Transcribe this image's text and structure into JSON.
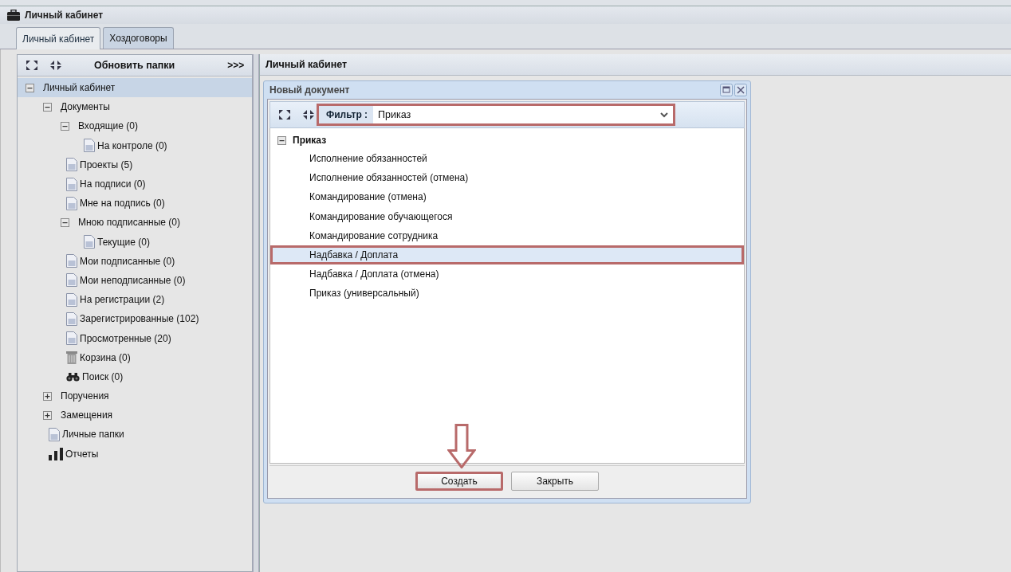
{
  "window": {
    "title": "Личный кабинет"
  },
  "tabs": [
    {
      "label": "Личный кабинет",
      "selected": true
    },
    {
      "label": "Хоздоговоры",
      "selected": false
    }
  ],
  "sidebar": {
    "toolbar": {
      "refresh": "Обновить папки",
      "more": ">>>"
    },
    "tree": [
      {
        "label": "Личный кабинет",
        "kind": "folder",
        "expanded": true,
        "selected": true,
        "children": [
          {
            "label": "Документы",
            "kind": "folder",
            "expanded": true,
            "selected": false,
            "children": [
              {
                "label": "Входящие (0)",
                "kind": "folder",
                "expanded": true,
                "selected": false,
                "children": [
                  {
                    "label": "На контроле (0)",
                    "kind": "document",
                    "selected": false
                  }
                ]
              },
              {
                "label": "Проекты (5)",
                "kind": "document",
                "selected": false
              },
              {
                "label": "На подписи (0)",
                "kind": "document",
                "selected": false
              },
              {
                "label": "Мне на подпись (0)",
                "kind": "document",
                "selected": false
              },
              {
                "label": "Мною подписанные (0)",
                "kind": "folder",
                "expanded": true,
                "selected": false,
                "children": [
                  {
                    "label": "Текущие (0)",
                    "kind": "document",
                    "selected": false
                  }
                ]
              },
              {
                "label": "Мои подписанные (0)",
                "kind": "document",
                "selected": false
              },
              {
                "label": "Мои неподписанные (0)",
                "kind": "document",
                "selected": false
              },
              {
                "label": "На регистрации (2)",
                "kind": "document",
                "selected": false
              },
              {
                "label": "Зарегистрированные (102)",
                "kind": "document",
                "selected": false
              },
              {
                "label": "Просмотренные (20)",
                "kind": "document",
                "selected": false
              },
              {
                "label": "Корзина (0)",
                "kind": "trash",
                "selected": false
              },
              {
                "label": "Поиск (0)",
                "kind": "search",
                "selected": false
              }
            ]
          },
          {
            "label": "Поручения",
            "kind": "folder",
            "expanded": false,
            "selected": false
          },
          {
            "label": "Замещения",
            "kind": "folder",
            "expanded": false,
            "selected": false
          },
          {
            "label": "Личные папки",
            "kind": "document",
            "selected": false
          },
          {
            "label": "Отчеты",
            "kind": "chart",
            "selected": false
          }
        ]
      }
    ]
  },
  "main": {
    "title": "Личный кабинет"
  },
  "dialog": {
    "title": "Новый документ",
    "filter": {
      "label": "Фильтр :",
      "value": "Приказ",
      "annotated": true
    },
    "group": {
      "label": "Приказ",
      "expanded": true
    },
    "items": [
      {
        "label": "Исполнение обязанностей",
        "selected": false,
        "annotated": false
      },
      {
        "label": "Исполнение обязанностей (отмена)",
        "selected": false,
        "annotated": false
      },
      {
        "label": "Командирование (отмена)",
        "selected": false,
        "annotated": false
      },
      {
        "label": "Командирование обучающегося",
        "selected": false,
        "annotated": false
      },
      {
        "label": "Командирование сотрудника",
        "selected": false,
        "annotated": false
      },
      {
        "label": "Надбавка / Доплата",
        "selected": true,
        "annotated": true
      },
      {
        "label": "Надбавка / Доплата (отмена)",
        "selected": false,
        "annotated": false
      },
      {
        "label": "Приказ (универсальный)",
        "selected": false,
        "annotated": false
      }
    ],
    "buttons": [
      {
        "label": "Создать",
        "annotated": true,
        "arrow": true
      },
      {
        "label": "Закрыть",
        "annotated": false,
        "arrow": false
      }
    ]
  }
}
